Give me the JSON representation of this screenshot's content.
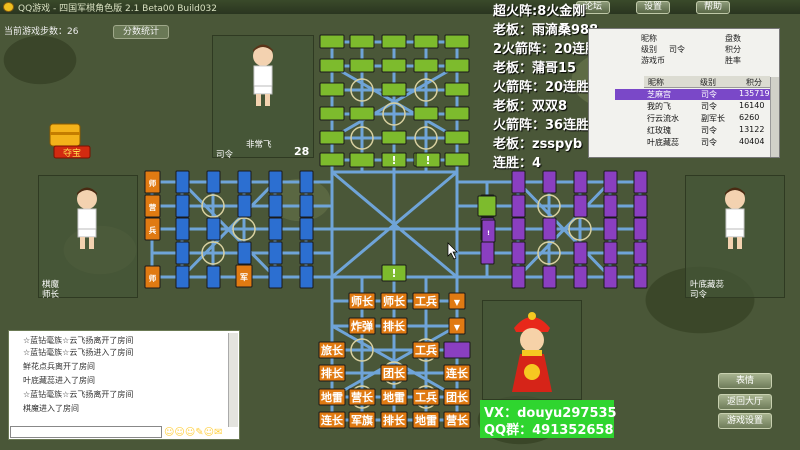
{
  "window": {
    "title": "QQ游戏 - 四国军棋角色版 2.1 Beta00 Build032",
    "buttons": [
      "论坛",
      "设置",
      "帮助"
    ]
  },
  "status": {
    "steps": "当前游戏步数：26",
    "stats_button": "分数统计"
  },
  "players_board": {
    "top": {
      "name": "非常飞",
      "rank": "司令",
      "count": "28"
    },
    "left": {
      "name": "棋魔",
      "rank": "师长"
    },
    "right": {
      "name": "叶底藏蕊",
      "rank": "司令"
    },
    "treasure_label": "夺宝"
  },
  "overlay_text": [
    "超火阵:8火金刚",
    "老板：雨滴桑988",
    "2火箭阵：20连胜 2次",
    "老板：蒲哥15",
    "火箭阵：20连胜 2次",
    "老板：双双8",
    "火箭阵：36连胜",
    "老板：zsspyb",
    "连胜：4"
  ],
  "player_panel": {
    "labels": [
      "昵称",
      "级别",
      "积分",
      "胜率",
      "盘数",
      "游戏币"
    ],
    "self_rank": "司令",
    "columns": [
      "昵称",
      "级别",
      "积分"
    ],
    "rows": [
      {
        "name": "芝麻宫",
        "rank": "司令",
        "score": "135719",
        "selected": true
      },
      {
        "name": "我的飞",
        "rank": "司令",
        "score": "16140"
      },
      {
        "name": "行云流水",
        "rank": "副军长",
        "score": "6260"
      },
      {
        "name": "红玫瑰",
        "rank": "司令",
        "score": "13122"
      },
      {
        "name": "叶底藏蕊",
        "rank": "司令",
        "score": "40404"
      }
    ]
  },
  "pieces": {
    "left_column": [
      "师",
      "营",
      "兵",
      "师"
    ],
    "left_special": "军",
    "bottom_rows": [
      [
        "师长",
        "师长",
        "工兵",
        "▼"
      ],
      [
        "炸弹",
        "排长",
        "",
        "▼"
      ],
      [
        "旅长",
        "",
        "工兵",
        ""
      ],
      [
        "排长",
        "",
        "团长",
        "连长"
      ],
      [
        "地雷",
        "营长",
        "地雷",
        "工兵",
        "团长"
      ],
      [
        "连长",
        "军旗",
        "排长",
        "地雷",
        "营长"
      ]
    ],
    "flag_mark": "!"
  },
  "chat": {
    "lines": [
      "☆蓝钻毫族☆云飞扬离开了房间",
      "☆蓝钻毫族☆云飞扬进入了房间",
      "鲜花点兵离开了房间",
      "叶底藏蕊进入了房间",
      "☆蓝钻毫族☆云飞扬离开了房间",
      "棋魔进入了房间"
    ]
  },
  "buttons": {
    "emotion": "表情",
    "exit": "返回大厅",
    "game_settings": "游戏设置"
  },
  "contact": {
    "vx": "VX：douyu297535",
    "qq": "QQ群：491352658"
  },
  "colors": {
    "blue": "#2c6fd1",
    "purple": "#8a3fc0",
    "green": "#7dbb2d",
    "orange": "#e07a12",
    "rail": "#6fa4d8"
  }
}
